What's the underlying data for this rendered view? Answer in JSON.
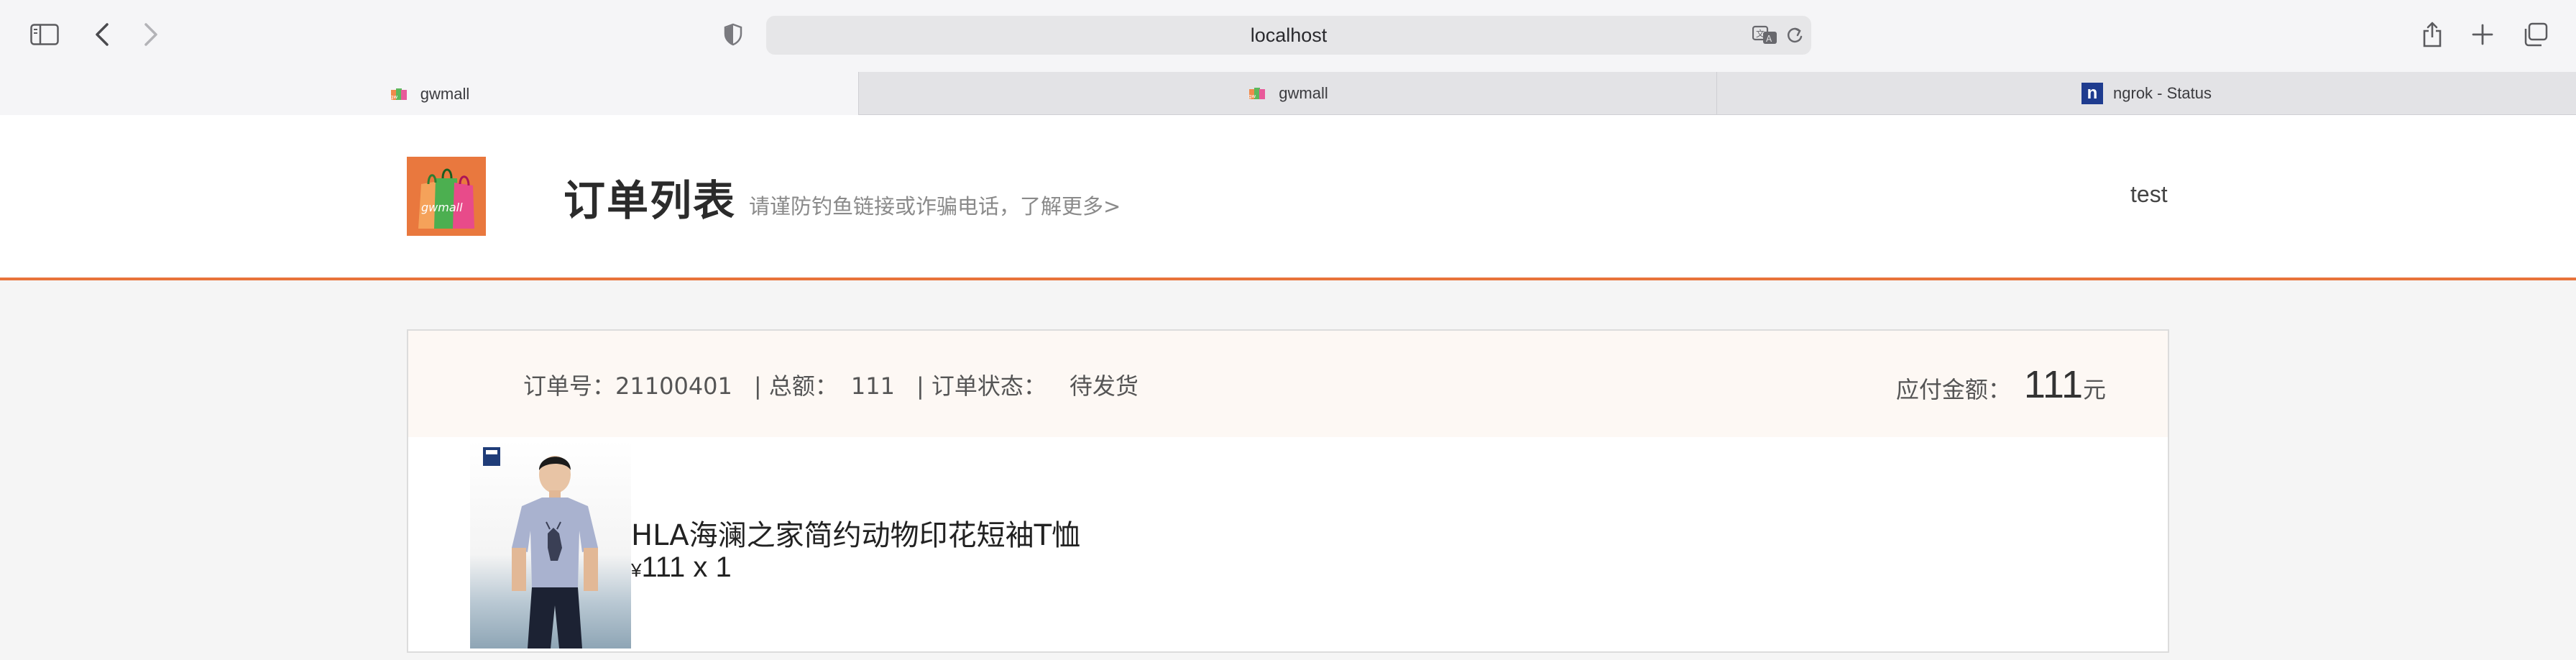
{
  "browser": {
    "address": "localhost",
    "tabs": [
      {
        "title": "gwmall",
        "active": true
      },
      {
        "title": "gwmall",
        "active": false
      },
      {
        "title": "ngrok - Status",
        "active": false
      }
    ]
  },
  "header": {
    "title": "订单列表",
    "warning": "请谨防钓鱼链接或诈骗电话，了解更多>",
    "username": "test",
    "accent_color": "#e8733a"
  },
  "order": {
    "number_label": "订单号：",
    "number": "21100401",
    "total_label": "| 总额：",
    "total": "111",
    "status_label": "| 订单状态：",
    "status": "待发货",
    "payable_label": "应付金额：",
    "payable_amount": "111",
    "payable_unit": "元",
    "items": [
      {
        "name": "HLA海澜之家简约动物印花短袖T恤",
        "currency": "¥",
        "price_qty": "111 x 1"
      }
    ]
  }
}
